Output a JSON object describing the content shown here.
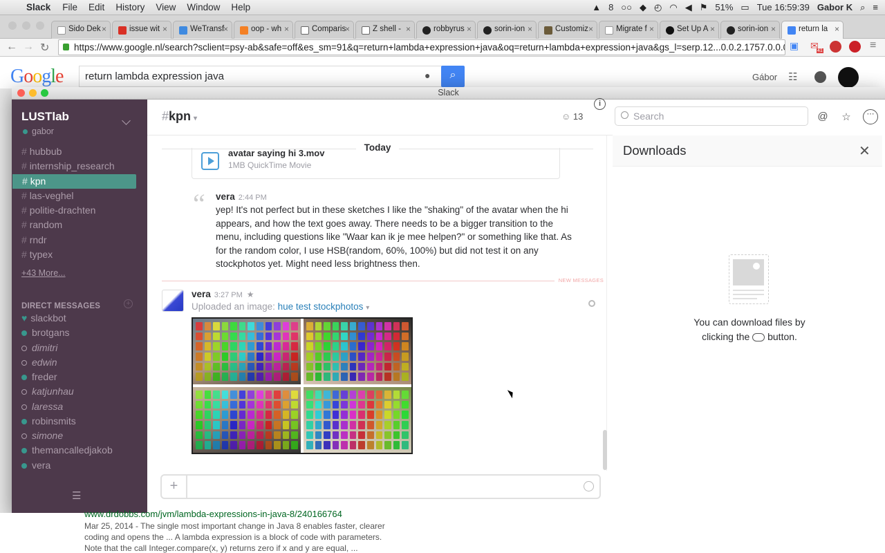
{
  "menubar": {
    "app": "Slack",
    "items": [
      "File",
      "Edit",
      "History",
      "View",
      "Window",
      "Help"
    ],
    "adobe": "8",
    "battery": "51%",
    "clock": "Tue 16:59:39",
    "user": "Gabor K"
  },
  "browser": {
    "tabs": [
      "Sido Dek",
      "issue wit",
      "WeTransf",
      "oop - wh",
      "Comparis",
      "Z shell -",
      "robbyrus",
      "sorin-ion",
      "Customiz",
      "Migrate f",
      "Set Up A",
      "sorin-ion",
      "return la"
    ],
    "url": "https://www.google.nl/search?sclient=psy-ab&safe=off&es_sm=91&q=return+lambda+expression+java&oq=return+lambda+expression+java&gs_l=serp.12...0.0.2.1757.0.0.0.0...",
    "google_logo": "Google",
    "query": "return lambda expression java",
    "user": "Gábor",
    "mail_count": "41"
  },
  "slack": {
    "window_title": "Slack",
    "team": "LUSTlab",
    "user": "gabor",
    "channels": [
      {
        "name": "hubbub"
      },
      {
        "name": "internship_research"
      },
      {
        "name": "kpn"
      },
      {
        "name": "las-veghel"
      },
      {
        "name": "politie-drachten"
      },
      {
        "name": "random"
      },
      {
        "name": "rndr"
      },
      {
        "name": "typex"
      }
    ],
    "more_link": "+43 More...",
    "dm_header": "DIRECT MESSAGES",
    "dms": [
      {
        "name": "slackbot"
      },
      {
        "name": "brotgans"
      },
      {
        "name": "dimitri"
      },
      {
        "name": "edwin"
      },
      {
        "name": "freder"
      },
      {
        "name": "katjunhau"
      },
      {
        "name": "laressa"
      },
      {
        "name": "robinsmits"
      },
      {
        "name": "simone"
      },
      {
        "name": "themancalledjakob"
      },
      {
        "name": "vera"
      }
    ],
    "channel_name": "kpn",
    "member_count": "13",
    "search_placeholder": "Search",
    "date_divider": "Today",
    "file": {
      "title": "avatar saying hi 3.mov",
      "meta": "1MB QuickTime Movie"
    },
    "msg1": {
      "author": "vera",
      "time": "2:44 PM",
      "text": "yep! It's not perfect but in these sketches I like the \"shaking\" of the avatar when the hi appears,  and how the text goes away. There needs to be a bigger transition to the menu, including questions like \"Waar kan ik je mee helpen?\" or something like that. As for the random color, I use HSB(random, 60%, 100%) but did not test it on any stockphotos yet. Might need less brightness then."
    },
    "new_messages": "NEW MESSAGES",
    "msg2": {
      "author": "vera",
      "time": "3:27 PM",
      "uploaded": "Uploaded an image:",
      "link": "hue test stockphotos"
    },
    "downloads": {
      "title": "Downloads",
      "msg_a": "You can download files by clicking the",
      "msg_b": "button."
    }
  },
  "below": {
    "url": "www.drdobbs.com/jvm/lambda-expressions-in-java-8/240166764",
    "line1": "Mar 25, 2014 - The single most important change in Java 8 enables faster, clearer",
    "line2": "coding and opens the ... A lambda expression is a block of code with parameters.",
    "line3": "Note that the call Integer.compare(x, y) returns zero if x and y are equal, ..."
  }
}
